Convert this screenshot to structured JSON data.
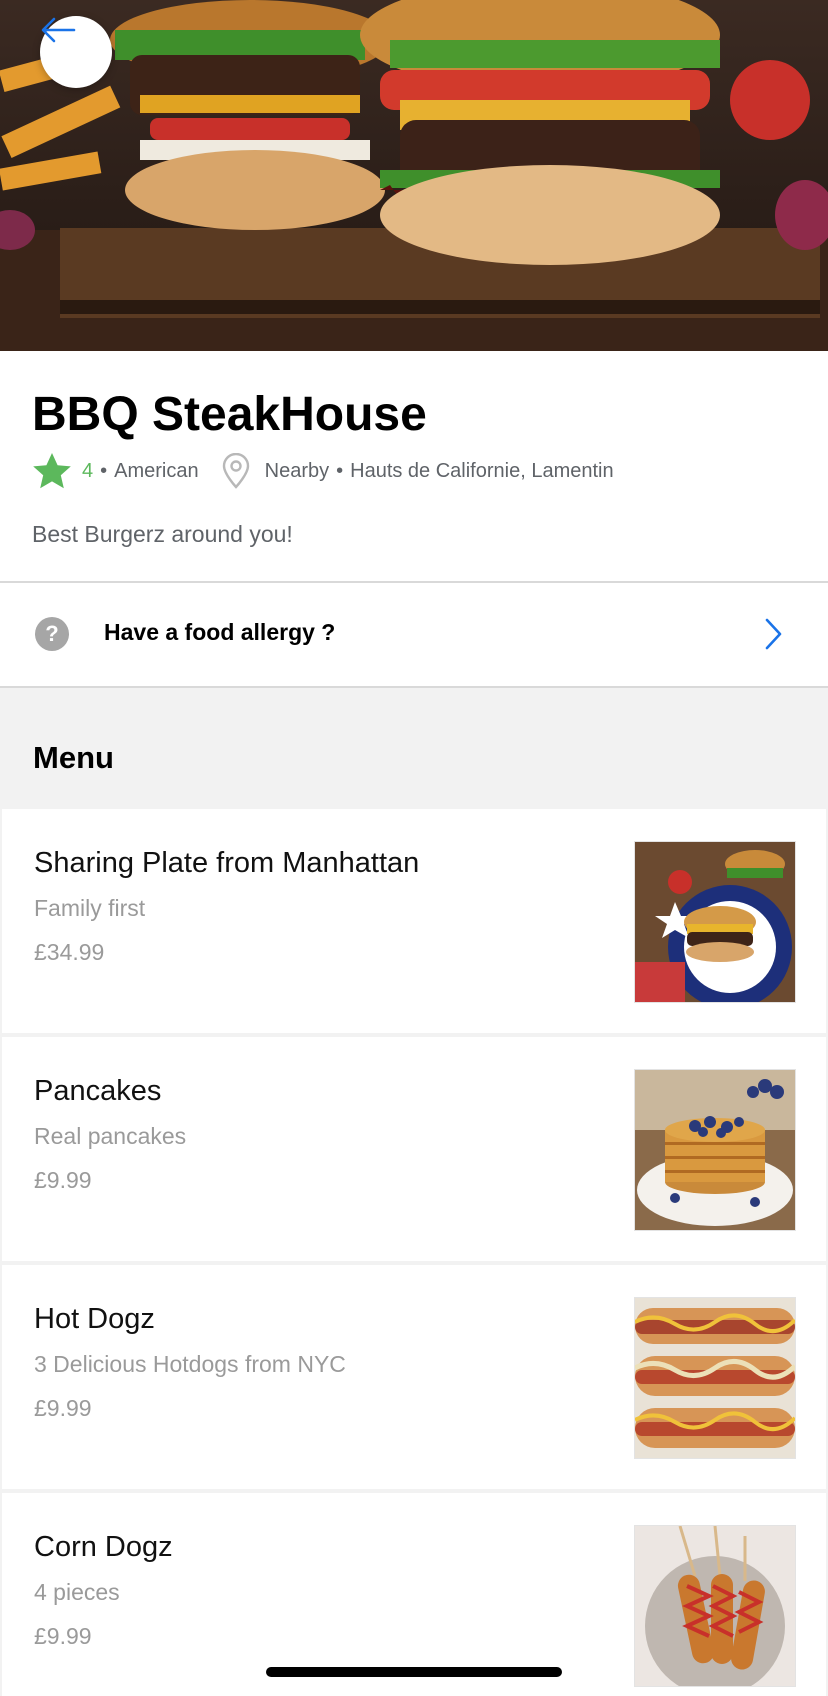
{
  "restaurant": {
    "name": "BBQ SteakHouse",
    "rating": "4",
    "cuisine": "American",
    "distance": "Nearby",
    "location": "Hauts de Californie, Lamentin",
    "tagline": "Best Burgerz around you!",
    "separator": "•"
  },
  "icons": {
    "back": "arrow-left-icon",
    "star": "star-icon",
    "pin": "map-pin-icon",
    "help": "question-icon",
    "chevron": "chevron-right-icon"
  },
  "allergy": {
    "label": "Have a food allergy ?",
    "icon_text": "?"
  },
  "menu": {
    "heading": "Menu",
    "items": [
      {
        "name": "Sharing Plate from Manhattan",
        "description": "Family first",
        "price": "£34.99"
      },
      {
        "name": "Pancakes",
        "description": "Real pancakes",
        "price": "£9.99"
      },
      {
        "name": "Hot Dogz",
        "description": "3 Delicious Hotdogs from NYC",
        "price": "£9.99"
      },
      {
        "name": "Corn Dogz",
        "description": "4 pieces",
        "price": "£9.99"
      }
    ]
  },
  "colors": {
    "accent": "#1a73e8",
    "rating": "#5cb85c",
    "muted": "#9a9a9a",
    "section_bg": "#f2f2f2"
  }
}
